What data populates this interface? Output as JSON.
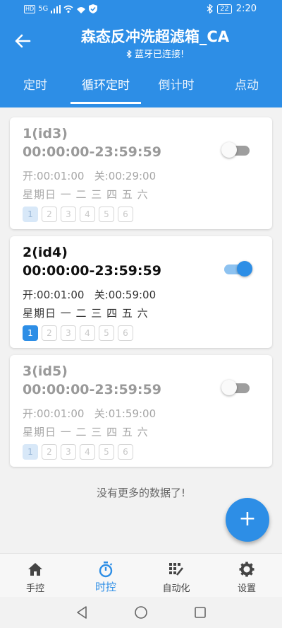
{
  "status": {
    "left_badge": "HD",
    "network": "5G",
    "time": "2:20",
    "battery": "22"
  },
  "header": {
    "title": "森态反冲洗超滤箱_CA",
    "subtitle": "蓝牙已连接!"
  },
  "tabs": [
    {
      "label": "定时",
      "active": false
    },
    {
      "label": "循环定时",
      "active": true
    },
    {
      "label": "倒计时",
      "active": false
    },
    {
      "label": "点动",
      "active": false
    }
  ],
  "cards": [
    {
      "name": "1(id3)",
      "range": "00:00:00-23:59:59",
      "onoff": "开:00:01:00   关:00:29:00",
      "week": "星期日 一 二 三 四 五 六",
      "enabled": false,
      "slots": [
        "1",
        "2",
        "3",
        "4",
        "5",
        "6"
      ]
    },
    {
      "name": "2(id4)",
      "range": "00:00:00-23:59:59",
      "onoff": "开:00:01:00   关:00:59:00",
      "week": "星期日 一 二 三 四 五 六",
      "enabled": true,
      "slots": [
        "1",
        "2",
        "3",
        "4",
        "5",
        "6"
      ]
    },
    {
      "name": "3(id5)",
      "range": "00:00:00-23:59:59",
      "onoff": "开:00:01:00   关:01:59:00",
      "week": "星期日 一 二 三 四 五 六",
      "enabled": false,
      "slots": [
        "1",
        "2",
        "3",
        "4",
        "5",
        "6"
      ]
    }
  ],
  "footer_text": "没有更多的数据了!",
  "fab_label": "+",
  "bottom_nav": [
    {
      "label": "手控",
      "icon": "home-icon",
      "active": false
    },
    {
      "label": "时控",
      "icon": "stopwatch-icon",
      "active": true
    },
    {
      "label": "自动化",
      "icon": "automation-icon",
      "active": false
    },
    {
      "label": "设置",
      "icon": "gear-icon",
      "active": false
    }
  ],
  "colors": {
    "primary": "#2d8ee6",
    "background": "#f2f2f2"
  }
}
